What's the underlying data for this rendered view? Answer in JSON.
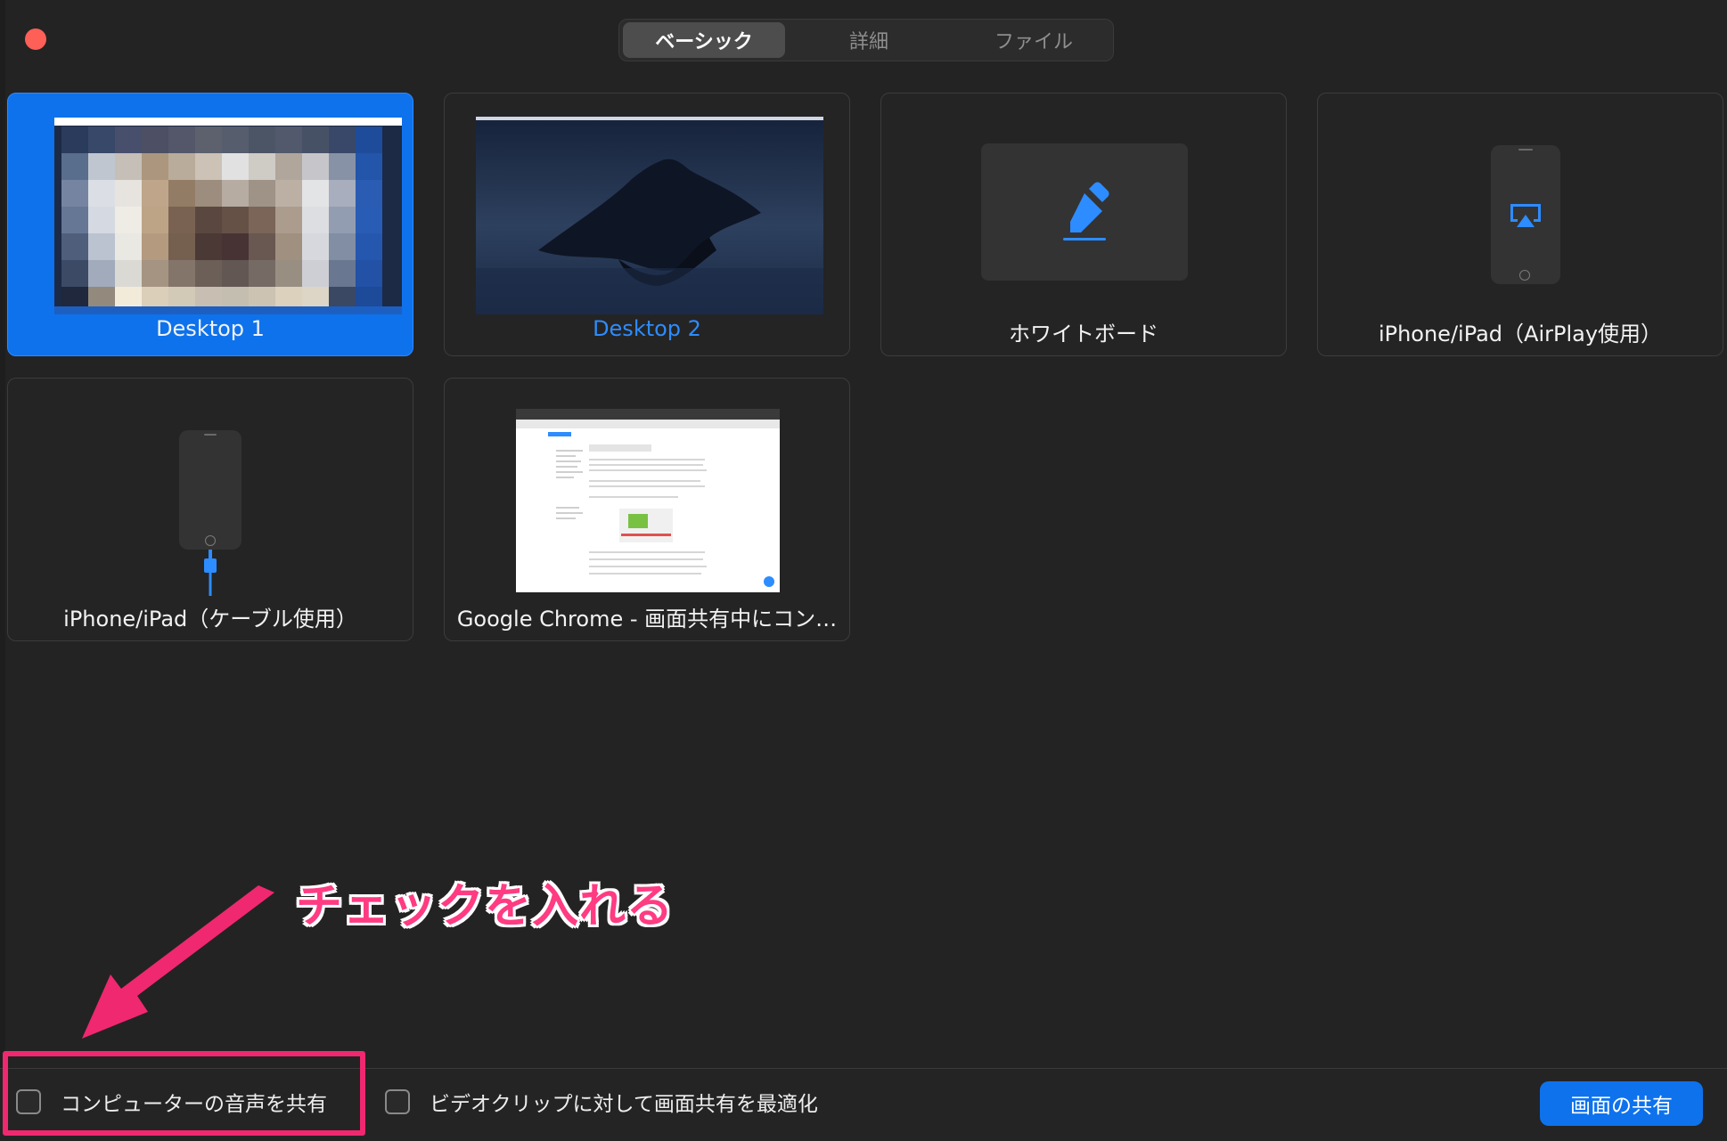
{
  "tabs": [
    {
      "label": "ベーシック",
      "active": true
    },
    {
      "label": "詳細",
      "active": false
    },
    {
      "label": "ファイル",
      "active": false
    }
  ],
  "tiles": {
    "desktop1": {
      "label": "Desktop 1",
      "selected": true
    },
    "desktop2": {
      "label": "Desktop 2"
    },
    "whiteboard": {
      "label": "ホワイトボード"
    },
    "airplay": {
      "label": "iPhone/iPad（AirPlay使用）"
    },
    "cable": {
      "label": "iPhone/iPad（ケーブル使用）"
    },
    "chrome": {
      "label": "Google Chrome - 画面共有中にコン…"
    }
  },
  "footer": {
    "share_audio_label": "コンピューターの音声を共有",
    "optimize_video_label": "ビデオクリップに対して画面共有を最適化",
    "share_button_label": "画面の共有"
  },
  "annotation": {
    "text": "チェックを入れる",
    "color": "#f0286f"
  },
  "colors": {
    "accent": "#0e72ed",
    "background": "#232323",
    "close_button": "#fe5f57"
  },
  "icons": {
    "close": "close-dot-icon",
    "whiteboard": "marker-pen-icon",
    "airplay": "airplay-icon",
    "cable": "lightning-cable-icon"
  }
}
